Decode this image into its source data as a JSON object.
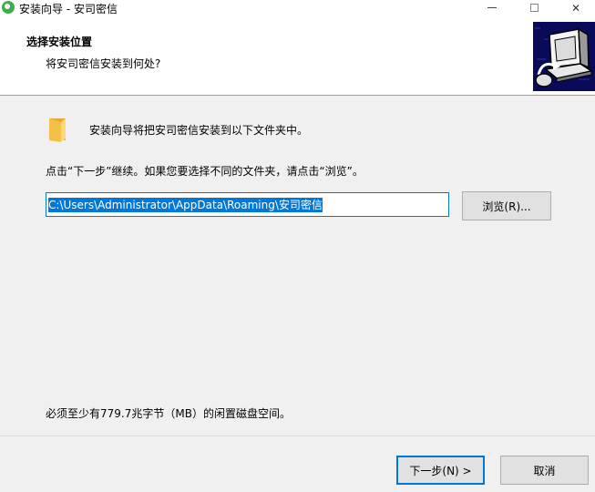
{
  "window": {
    "title": "安装向导 - 安司密信",
    "controls": {
      "minimize": "",
      "maximize": "",
      "close": "✕"
    }
  },
  "header": {
    "title": "选择安装位置",
    "subtitle": "将安司密信安装到何处?"
  },
  "body": {
    "intro": "安装向导将把安司密信安装到以下文件夹中。",
    "instruction": "点击“下一步”继续。如果您要选择不同的文件夹，请点击“浏览”。",
    "install_path": "C:\\Users\\Administrator\\AppData\\Roaming\\安司密信",
    "browse_label": "浏览(R)...",
    "disk_space": "必须至少有779.7兆字节（MB）的闲置磁盘空间。"
  },
  "footer": {
    "next_label": "下一步(N) >",
    "cancel_label": "取消"
  },
  "colors": {
    "accent": "#0078d7",
    "header_bg": "#ffffff",
    "body_bg": "#f0f0f0",
    "image_bg": "#0a0a5a",
    "app_icon": "#3fae4a",
    "folder": "#f5c04a"
  }
}
